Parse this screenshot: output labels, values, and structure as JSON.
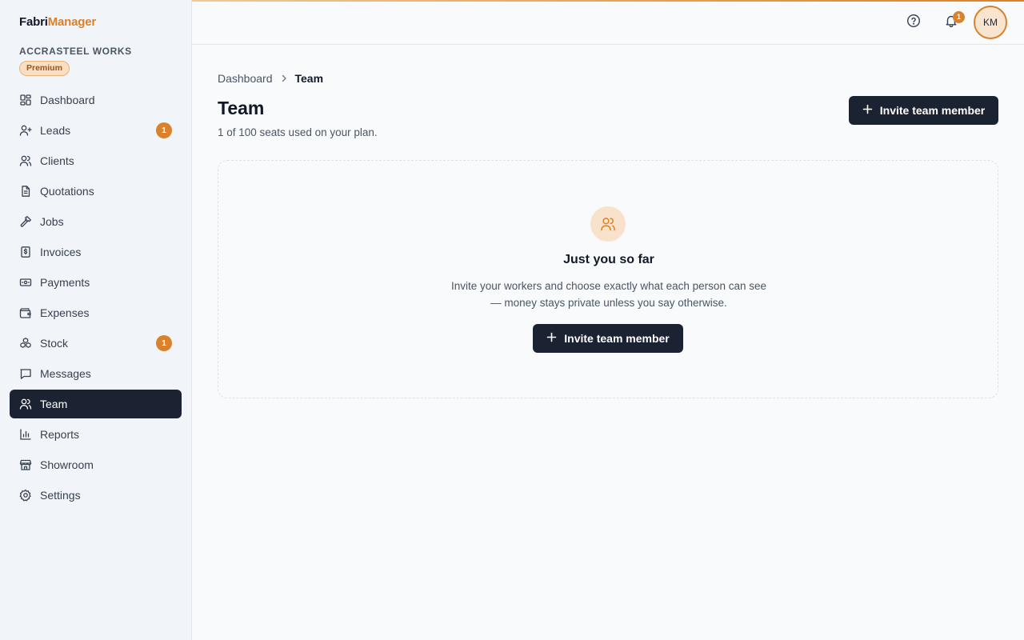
{
  "brand": {
    "part1": "Fabri",
    "part2": "Manager",
    "accent": "#d9822b"
  },
  "org": {
    "name": "ACCRASTEEL WORKS",
    "plan": "Premium"
  },
  "nav": [
    {
      "label": "Dashboard",
      "icon": "dashboard-icon"
    },
    {
      "label": "Leads",
      "icon": "user-plus-icon",
      "badge": "1"
    },
    {
      "label": "Clients",
      "icon": "users-icon"
    },
    {
      "label": "Quotations",
      "icon": "document-icon"
    },
    {
      "label": "Jobs",
      "icon": "hammer-icon"
    },
    {
      "label": "Invoices",
      "icon": "invoice-icon"
    },
    {
      "label": "Payments",
      "icon": "banknote-icon"
    },
    {
      "label": "Expenses",
      "icon": "wallet-icon"
    },
    {
      "label": "Stock",
      "icon": "boxes-icon",
      "badge": "1"
    },
    {
      "label": "Messages",
      "icon": "message-icon"
    },
    {
      "label": "Team",
      "icon": "team-icon",
      "active": true
    },
    {
      "label": "Reports",
      "icon": "bar-chart-icon"
    },
    {
      "label": "Showroom",
      "icon": "store-icon"
    },
    {
      "label": "Settings",
      "icon": "gear-icon"
    }
  ],
  "header": {
    "notifications": "1",
    "avatar_initials": "KM"
  },
  "breadcrumb": {
    "parent": "Dashboard",
    "current": "Team"
  },
  "page": {
    "title": "Team",
    "subtitle": "1 of 100 seats used on your plan.",
    "invite_label": "Invite team member"
  },
  "empty": {
    "title": "Just you so far",
    "text": "Invite your workers and choose exactly what each person can see — money stays private unless you say otherwise.",
    "invite_label": "Invite team member"
  }
}
